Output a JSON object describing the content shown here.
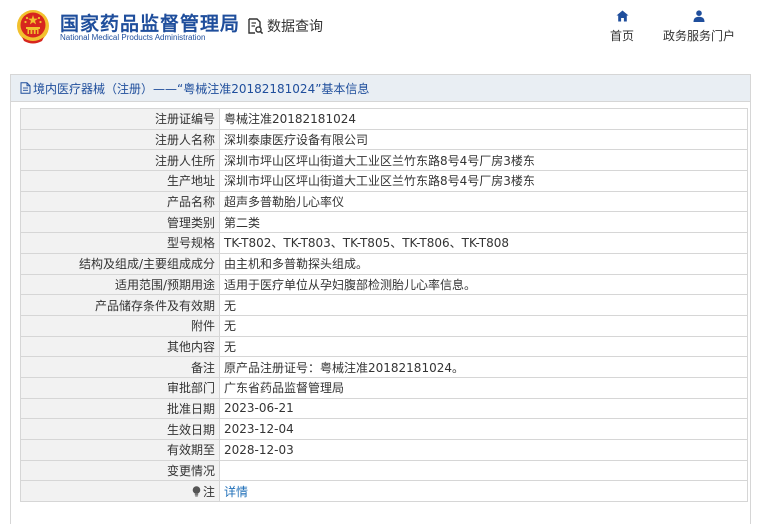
{
  "header": {
    "agency_name_cn": "国家药品监督管理局",
    "agency_name_en": "National Medical Products Administration",
    "query_label": "数据查询",
    "nav": [
      {
        "label": "首页",
        "icon": "home-icon"
      },
      {
        "label": "政务服务门户",
        "icon": "user-icon"
      }
    ]
  },
  "panel": {
    "title": "境内医疗器械（注册）——“粤械注准20182181024”基本信息"
  },
  "rows": [
    {
      "key": "注册证编号",
      "value": "粤械注准20182181024"
    },
    {
      "key": "注册人名称",
      "value": "深圳泰康医疗设备有限公司"
    },
    {
      "key": "注册人住所",
      "value": "深圳市坪山区坪山街道大工业区兰竹东路8号4号厂房3楼东"
    },
    {
      "key": "生产地址",
      "value": "深圳市坪山区坪山街道大工业区兰竹东路8号4号厂房3楼东"
    },
    {
      "key": "产品名称",
      "value": "超声多普勒胎儿心率仪"
    },
    {
      "key": "管理类别",
      "value": "第二类"
    },
    {
      "key": "型号规格",
      "value": "TK-T802、TK-T803、TK-T805、TK-T806、TK-T808"
    },
    {
      "key": "结构及组成/主要组成成分",
      "value": "由主机和多普勒探头组成。"
    },
    {
      "key": "适用范围/预期用途",
      "value": "适用于医疗单位从孕妇腹部检测胎儿心率信息。"
    },
    {
      "key": "产品储存条件及有效期",
      "value": "无"
    },
    {
      "key": "附件",
      "value": "无"
    },
    {
      "key": "其他内容",
      "value": "无"
    },
    {
      "key": "备注",
      "value": "原产品注册证号：粤械注准20182181024。"
    },
    {
      "key": "审批部门",
      "value": "广东省药品监督管理局"
    },
    {
      "key": "批准日期",
      "value": "2023-06-21"
    },
    {
      "key": "生效日期",
      "value": "2023-12-04"
    },
    {
      "key": "有效期至",
      "value": "2028-12-03"
    },
    {
      "key": "变更情况",
      "value": ""
    }
  ],
  "note_row": {
    "key": "注",
    "link_label": "详情",
    "icon": "lightbulb-icon"
  },
  "colors": {
    "brand_blue": "#1f4e9c",
    "link_blue": "#1f6fb8",
    "emblem_red": "#d7261e",
    "emblem_gold": "#f2c12e",
    "key_bg": "#f2f2f2",
    "title_bg": "#e9eef3"
  }
}
